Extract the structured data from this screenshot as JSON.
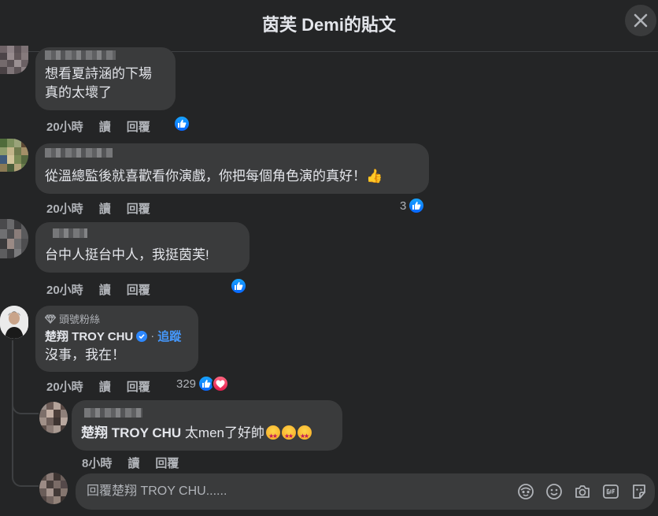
{
  "header": {
    "title": "茵芙 Demi的貼文"
  },
  "comments": [
    {
      "lines": [
        "想看夏詩涵的下場",
        "真的太壞了"
      ],
      "time": "20小時",
      "read": "讀",
      "reply": "回覆",
      "reaction_count": ""
    },
    {
      "lines": [
        "從溫總監後就喜歡看你演戲，你把每個角色演的真好！👍"
      ],
      "time": "20小時",
      "read": "讀",
      "reply": "回覆",
      "reaction_count": "3"
    },
    {
      "lines": [
        "台中人挺台中人，我挺茵芙!"
      ],
      "time": "20小時",
      "read": "讀",
      "reply": "回覆",
      "reaction_count": ""
    },
    {
      "badge": "頭號粉絲",
      "author": "楚翔 TROY CHU",
      "separator": "·",
      "follow": "追蹤",
      "lines": [
        "沒事，我在！"
      ],
      "time": "20小時",
      "read": "讀",
      "reply": "回覆",
      "reaction_count": "329"
    }
  ],
  "reply": {
    "mention": "楚翔 TROY CHU",
    "text": " 太men了好帥",
    "time": "8小時",
    "read": "讀",
    "reply": "回覆"
  },
  "composer": {
    "placeholder": "回覆楚翔 TROY CHU......"
  },
  "colors": {
    "like": "#0866ff",
    "love": "#e61e4d",
    "link": "#4599ff",
    "bubble": "#3a3b3c"
  }
}
